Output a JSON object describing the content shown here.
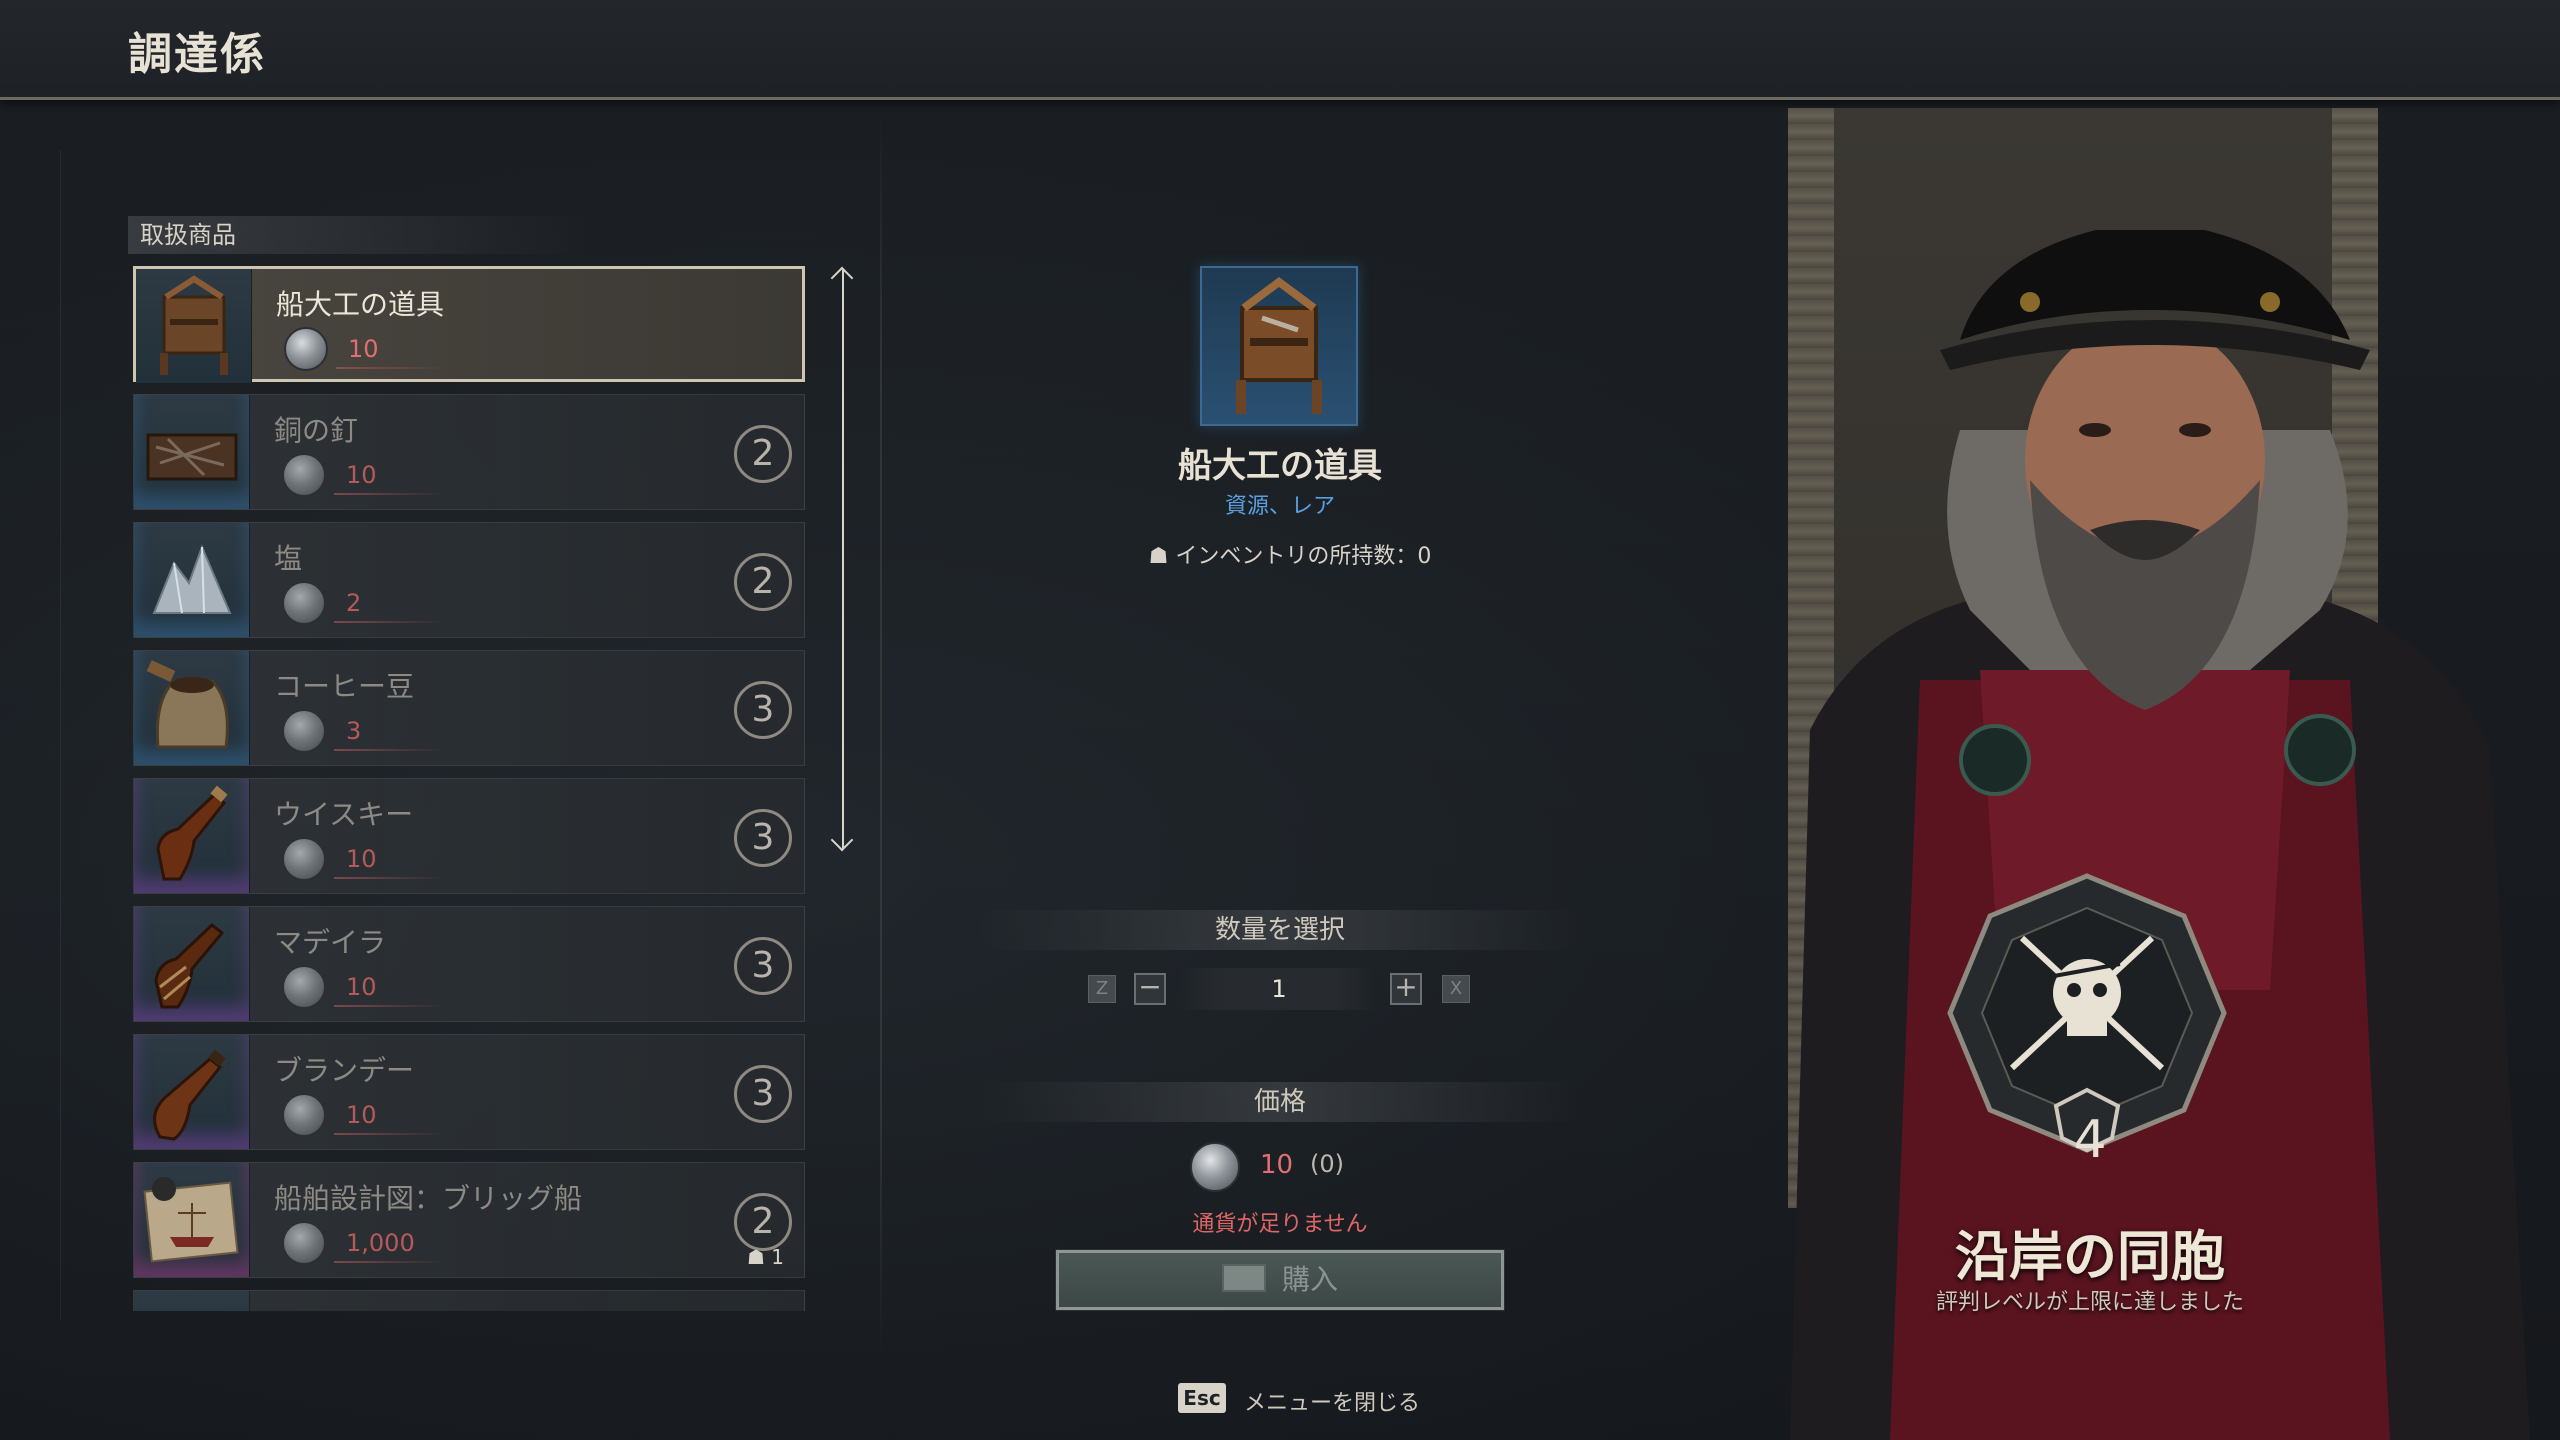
{
  "header": {
    "title": "調達係"
  },
  "list": {
    "section_label": "取扱商品",
    "items": [
      {
        "name": "船大工の道具",
        "price": "10",
        "level": "",
        "owned": "",
        "selected": true,
        "icon": "toolbox-icon"
      },
      {
        "name": "銅の釘",
        "price": "10",
        "level": "2",
        "owned": "",
        "selected": false,
        "icon": "nails-crate-icon"
      },
      {
        "name": "塩",
        "price": "2",
        "level": "2",
        "owned": "",
        "selected": false,
        "icon": "salt-crystal-icon"
      },
      {
        "name": "コーヒー豆",
        "price": "3",
        "level": "3",
        "owned": "",
        "selected": false,
        "icon": "coffee-sack-icon"
      },
      {
        "name": "ウイスキー",
        "price": "10",
        "level": "3",
        "owned": "",
        "selected": false,
        "icon": "whiskey-bottle-icon"
      },
      {
        "name": "マデイラ",
        "price": "10",
        "level": "3",
        "owned": "",
        "selected": false,
        "icon": "madeira-bottle-icon"
      },
      {
        "name": "ブランデー",
        "price": "10",
        "level": "3",
        "owned": "",
        "selected": false,
        "icon": "brandy-bottle-icon"
      },
      {
        "name": "船舶設計図：ブリッグ船",
        "price": "1,000",
        "level": "2",
        "owned": "1",
        "selected": false,
        "icon": "blueprint-icon"
      }
    ]
  },
  "detail": {
    "name": "船大工の道具",
    "type": "資源、レア",
    "inventory_label": "インベントリの所持数：0",
    "quantity_header": "数量を選択",
    "qty_key_minus": "Z",
    "qty_key_plus": "X",
    "quantity": "1",
    "price_header": "価格",
    "price": "10",
    "owned_currency": "(0)",
    "warning": "通貨が足りません",
    "buy_label": "購入"
  },
  "footer": {
    "key": "Esc",
    "label": "メニューを閉じる"
  },
  "faction": {
    "level": "4",
    "name": "沿岸の同胞",
    "status": "評判レベルが上限に達しました"
  },
  "colors": {
    "price_red": "#e07070",
    "rare_blue": "#5b9fe0",
    "accent_frame": "#cfc6b2"
  }
}
